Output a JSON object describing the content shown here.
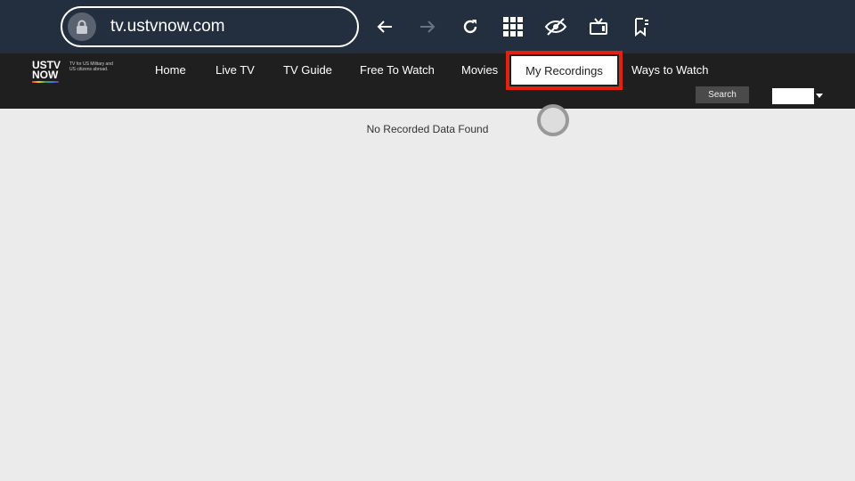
{
  "browser": {
    "url": "tv.ustvnow.com",
    "icons": [
      "lock-icon",
      "back-icon",
      "forward-icon",
      "reload-icon",
      "apps-grid-icon",
      "hide-icon",
      "tv-icon",
      "bookmark-icon"
    ]
  },
  "site": {
    "logo_text_line1": "USTV",
    "logo_text_line2": "NOW",
    "tagline": "TV for US Military and US citizens abroad.",
    "nav": [
      "Home",
      "Live TV",
      "TV Guide",
      "Free To Watch",
      "Movies",
      "My Recordings",
      "Ways to Watch"
    ],
    "active_nav": "My Recordings",
    "search_label": "Search",
    "select_value": ""
  },
  "main": {
    "message": "No Recorded Data Found"
  },
  "colors": {
    "highlight": "#e0220f",
    "browser_bar": "#232f3e",
    "site_header": "#1f1f1f"
  }
}
